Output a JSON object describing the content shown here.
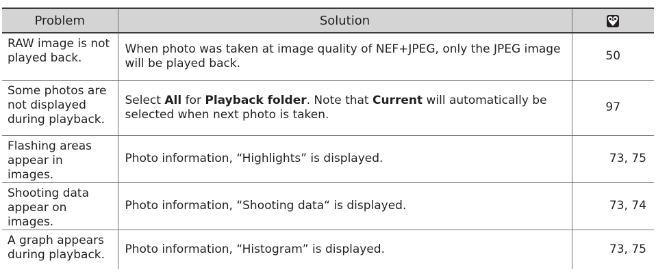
{
  "header": {
    "problem_label": "Problem",
    "solution_label": "Solution",
    "page_icon": "page-reference-icon"
  },
  "rows": [
    {
      "problem": "RAW image is not played back.",
      "solution": [
        {
          "text": "When photo was taken at image quality of NEF+JPEG, only the JPEG image will be played back.",
          "bold": false
        }
      ],
      "pages": "50"
    },
    {
      "problem": "Some photos are not displayed during playback.",
      "solution": [
        {
          "text": "Select ",
          "bold": false
        },
        {
          "text": "All",
          "bold": true
        },
        {
          "text": " for ",
          "bold": false
        },
        {
          "text": "Playback folder",
          "bold": true
        },
        {
          "text": ". Note that ",
          "bold": false
        },
        {
          "text": "Current",
          "bold": true
        },
        {
          "text": " will automatically be selected when next photo is taken.",
          "bold": false
        }
      ],
      "pages": "97"
    },
    {
      "problem": "Flashing areas appear in images.",
      "solution": [
        {
          "text": "Photo information, “Highlights” is displayed.",
          "bold": false
        }
      ],
      "pages": "73, 75"
    },
    {
      "problem": "Shooting data appear on images.",
      "solution": [
        {
          "text": "Photo information, “Shooting data“ is displayed.",
          "bold": false
        }
      ],
      "pages": "73, 74"
    },
    {
      "problem": "A graph appears during playback.",
      "solution": [
        {
          "text": "Photo information, “Histogram” is displayed.",
          "bold": false
        }
      ],
      "pages": "73, 75"
    }
  ]
}
